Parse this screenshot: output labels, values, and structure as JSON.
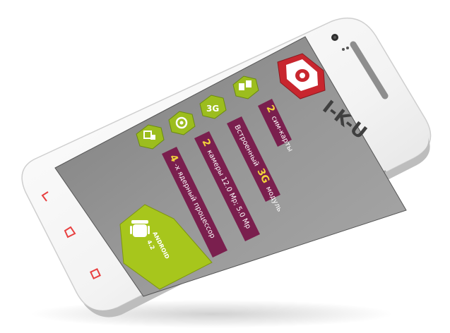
{
  "device": {
    "brand_logo_text": "I-K-U",
    "colors": {
      "body": "#f4f4f4",
      "screen": "#8c8c8c",
      "tile": "#7a1f4e",
      "hex": "#9cbd1e",
      "android_badge": "#a7c61c",
      "softkey": "#e84040"
    }
  },
  "screen": {
    "features": [
      {
        "prefix": "2",
        "text": "сим-карты",
        "icon": "sim-cards-icon"
      },
      {
        "prefix": "Встроенный",
        "highlight": "3G",
        "suffix": "модуль",
        "icon": "3g-icon"
      },
      {
        "prefix": "2",
        "text": "камеры 12.0 Мр; 5.0 Мр",
        "icon": "camera-icon"
      },
      {
        "prefix": "4",
        "text": "-х ядерный процессор",
        "icon": "cpu-icon"
      }
    ],
    "hex_3g_label": "3G",
    "android_badge": {
      "line1": "ANDROID",
      "line2": "4.2",
      "icon": "android-icon"
    }
  },
  "softkeys": [
    "back-icon",
    "home-icon",
    "recent-apps-icon"
  ]
}
